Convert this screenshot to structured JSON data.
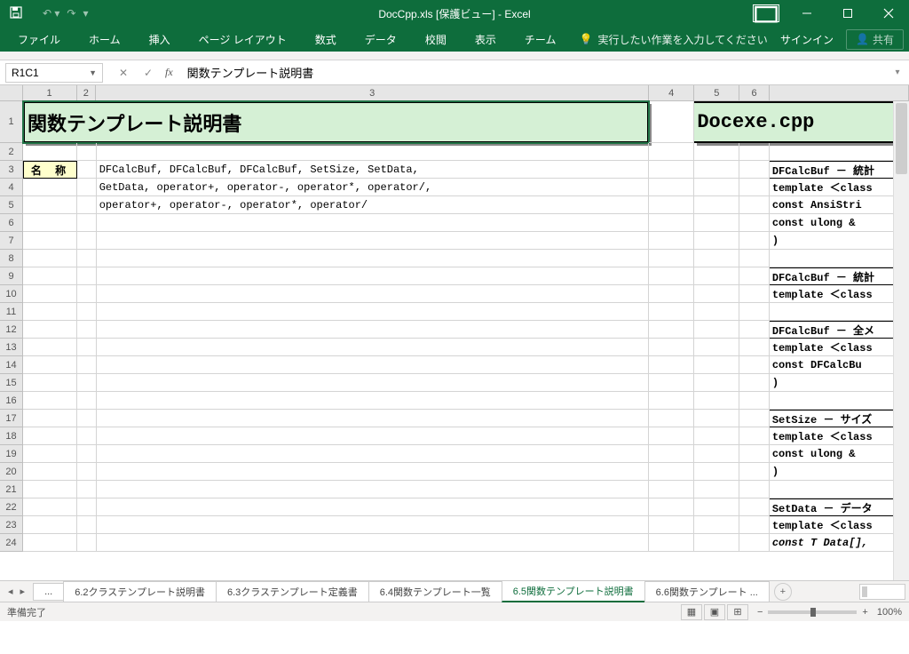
{
  "title": "DocCpp.xls [保護ビュー] - Excel",
  "ribbon": {
    "file": "ファイル",
    "home": "ホーム",
    "insert": "挿入",
    "layout": "ページ レイアウト",
    "formula": "数式",
    "data": "データ",
    "review": "校閲",
    "view": "表示",
    "team": "チーム",
    "tellme": "実行したい作業を入力してください",
    "signin": "サインイン",
    "share": "共有"
  },
  "namebox": "R1C1",
  "formula": "関数テンプレート説明書",
  "columns": [
    "1",
    "2",
    "3",
    "4",
    "5",
    "6",
    ""
  ],
  "rows": [
    "1",
    "2",
    "3",
    "4",
    "5",
    "6",
    "7",
    "8",
    "9",
    "10",
    "11",
    "12",
    "13",
    "14",
    "15",
    "16",
    "17",
    "18",
    "19",
    "20",
    "21",
    "22",
    "23",
    "24"
  ],
  "cells": {
    "title_left": "関数テンプレート説明書",
    "title_right": "Docexe.cpp",
    "label_name": "名 称",
    "r3": "DFCalcBuf, DFCalcBuf, DFCalcBuf, SetSize, SetData,",
    "r4": "GetData, operator+, operator-, operator*, operator/,",
    "r5": "operator+, operator-, operator*, operator/",
    "s3": "DFCalcBuf － 統計",
    "s4": "template ＜class",
    "s5": "  const AnsiStri",
    "s6": "  const ulong &",
    "s7": ")",
    "s9": "DFCalcBuf － 統計",
    "s10": "template ＜class",
    "s12": "DFCalcBuf － 全メ",
    "s13": "template ＜class",
    "s14": "  const DFCalcBu",
    "s15": ")",
    "s17": "SetSize － サイズ",
    "s18": "template ＜class",
    "s19": "  const ulong &",
    "s20": ")",
    "s22": "SetData － データ",
    "s23": "template ＜class",
    "s24": "  const T  Data[],"
  },
  "tabs": {
    "dots": "...",
    "t1": "6.2クラステンプレート説明書",
    "t2": "6.3クラステンプレート定義書",
    "t3": "6.4関数テンプレート一覧",
    "t4": "6.5関数テンプレート説明書",
    "t5": "6.6関数テンプレート ..."
  },
  "status": {
    "ready": "準備完了",
    "zoom": "100%"
  }
}
